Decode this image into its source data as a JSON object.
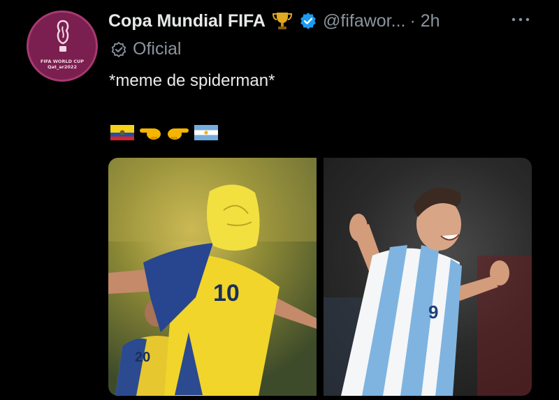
{
  "tweet": {
    "author_name": "Copa Mundial FIFA",
    "handle": "@fifawor...",
    "time": "· 2h",
    "affiliation_label": "Oficial",
    "text": "*meme de spiderman*",
    "avatar_text": "FIFA WORLD CUP Qat_ar2022"
  },
  "icons": {
    "trophy": "trophy-icon",
    "verified": "verified-icon",
    "more": "more-icon",
    "affiliation": "official-badge-icon",
    "emojis": [
      "ecuador-flag-icon",
      "pointing-left-icon",
      "pointing-right-icon",
      "argentina-flag-icon"
    ]
  },
  "media": {
    "images": [
      "ecuador-player-masked-photo",
      "argentina-player-celebrating-photo"
    ]
  },
  "colors": {
    "background": "#000000",
    "text": "#e7e9ea",
    "muted": "#8b949e",
    "verified_blue": "#1d9bf0",
    "avatar_maroon": "#7a1f4f"
  }
}
